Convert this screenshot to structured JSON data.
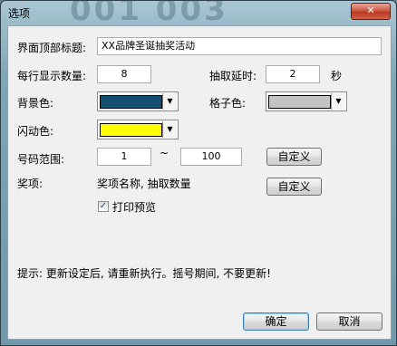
{
  "window": {
    "title": "选项",
    "close_symbol": "✕",
    "background_digits": "001      003"
  },
  "fields": {
    "top_title_label": "界面顶部标题:",
    "top_title_value": "XX品牌圣诞抽奖活动",
    "per_row_label": "每行显示数量:",
    "per_row_value": "8",
    "delay_label": "抽取延时:",
    "delay_value": "2",
    "delay_unit": "秒",
    "bg_color_label": "背景色:",
    "bg_color": "#154f70",
    "grid_color_label": "格子色:",
    "grid_color": "#c4c4c4",
    "flash_color_label": "闪动色:",
    "flash_color": "#ffff00",
    "dropdown_arrow": "▼",
    "range_label": "号码范围:",
    "range_from": "1",
    "range_sep": "~",
    "range_to": "100",
    "range_custom_button": "自定义",
    "prize_label": "奖项:",
    "prize_desc": "奖项名称, 抽取数量",
    "prize_custom_button": "自定义",
    "print_preview_label": "打印预览",
    "print_preview_checked": true,
    "check_mark": "✓"
  },
  "hint": "提示: 更新设定后, 请重新执行。摇号期间, 不要更新!",
  "buttons": {
    "ok": "确定",
    "cancel": "取消"
  }
}
